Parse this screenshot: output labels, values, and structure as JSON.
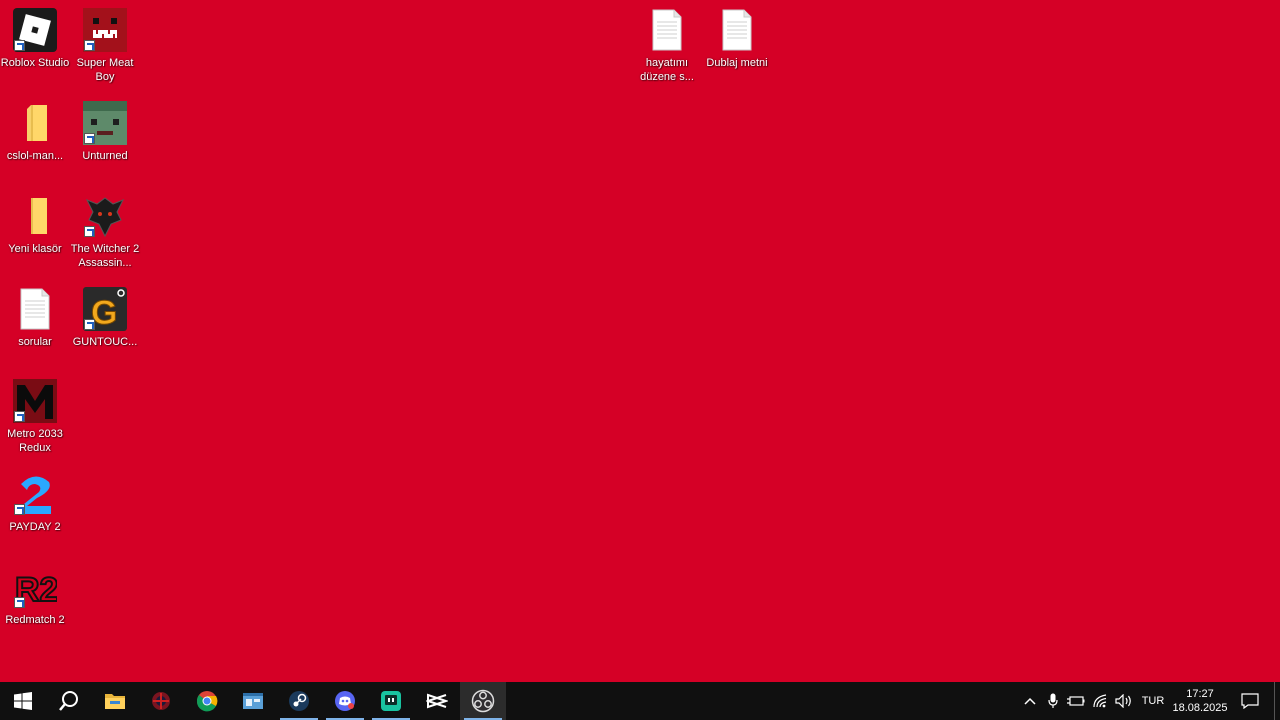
{
  "desktop_icons": [
    {
      "label": "Roblox Studio",
      "icon": "roblox-studio-icon"
    },
    {
      "label": "Super Meat Boy",
      "icon": "super-meat-boy-icon"
    },
    {
      "label": "cslol-man...",
      "icon": "folder-icon"
    },
    {
      "label": "Unturned",
      "icon": "unturned-icon"
    },
    {
      "label": "Yeni klasör",
      "icon": "folder-icon"
    },
    {
      "label": "The Witcher 2 Assassin...",
      "icon": "witcher-2-icon"
    },
    {
      "label": "sorular",
      "icon": "text-document-icon"
    },
    {
      "label": "GUNTOUC...",
      "icon": "guntouch-icon"
    },
    {
      "label": "Metro 2033 Redux",
      "icon": "metro-2033-icon"
    },
    {
      "label": "PAYDAY 2",
      "icon": "payday-2-icon"
    },
    {
      "label": "Redmatch 2",
      "icon": "redmatch-2-icon"
    },
    {
      "label": "hayatımı düzene s...",
      "icon": "text-document-icon"
    },
    {
      "label": "Dublaj metni",
      "icon": "text-document-icon"
    }
  ],
  "taskbar": {
    "apps": [
      "start-icon",
      "search-icon",
      "file-explorer-icon",
      "game-app-icon",
      "chrome-icon",
      "app-window-icon",
      "steam-icon",
      "discord-icon",
      "twitch-like-icon",
      "capcut-icon",
      "obs-icon"
    ],
    "tray": {
      "language": "TUR",
      "time": "17:27",
      "date": "18.08.2025"
    }
  },
  "colors": {
    "wallpaper": "#d50026",
    "taskbar": "#101010"
  }
}
